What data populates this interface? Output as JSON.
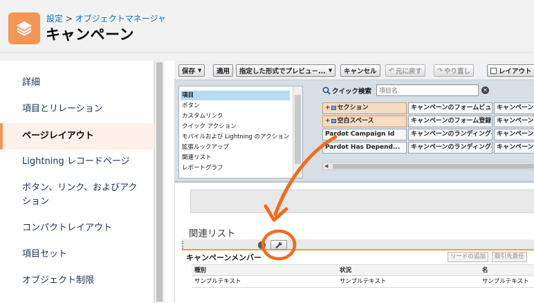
{
  "header": {
    "breadcrumb": [
      "設定",
      "オブジェクトマネージャ"
    ],
    "breadcrumb_sep": " > ",
    "title": "キャンペーン",
    "icon": "layers-icon",
    "accent": "#f49756"
  },
  "sidebar": {
    "items": [
      {
        "label": "詳細"
      },
      {
        "label": "項目とリレーション"
      },
      {
        "label": "ページレイアウト",
        "active": true
      },
      {
        "label": "Lightning レコードページ"
      },
      {
        "label": "ボタン、リンク、およびアクション"
      },
      {
        "label": "コンパクトレイアウト"
      },
      {
        "label": "項目セット"
      },
      {
        "label": "オブジェクト制限"
      }
    ]
  },
  "toolbar": {
    "save": "保存",
    "apply": "適用",
    "preview": "指定した形式でプレビュ－...",
    "cancel": "キャンセル",
    "undo": "元に戻す",
    "redo": "やり直し",
    "layout": "レイアウト"
  },
  "palette": {
    "categories": [
      "項目",
      "ボタン",
      "カスタムリンク",
      "クイック アクション",
      "モバイルおよび Lightning のアクション",
      "拡張ルックアップ",
      "関連リスト",
      "レポートグラフ"
    ],
    "quick_search_label": "クイック検索",
    "search_placeholder": "項目名",
    "fields": [
      [
        "セクション",
        "キャンペーンのフォームビュー",
        "キャンペーンの"
      ],
      [
        "空白スペース",
        "キャンペーンのフォーム登録",
        "キャンペーンの"
      ],
      [
        "Pardot Campaign Id",
        "キャンペーンのランディングペ",
        "キャンペーンの"
      ],
      [
        "Pardot Has Depend...",
        "キャンペーンのランディングペ",
        "キャンペーンの"
      ]
    ]
  },
  "layout": {
    "related_lists_heading": "関連リスト",
    "related_list": {
      "title": "キャンペーンメンバー",
      "buttons": [
        "リードの追加",
        "取引先責任"
      ],
      "columns": [
        "種別",
        "状況",
        "名"
      ],
      "row": [
        "サンプルテキスト",
        "サンプルテキスト",
        "サンプルテキスト"
      ]
    }
  },
  "annotation": {
    "color": "#f26b1d"
  }
}
